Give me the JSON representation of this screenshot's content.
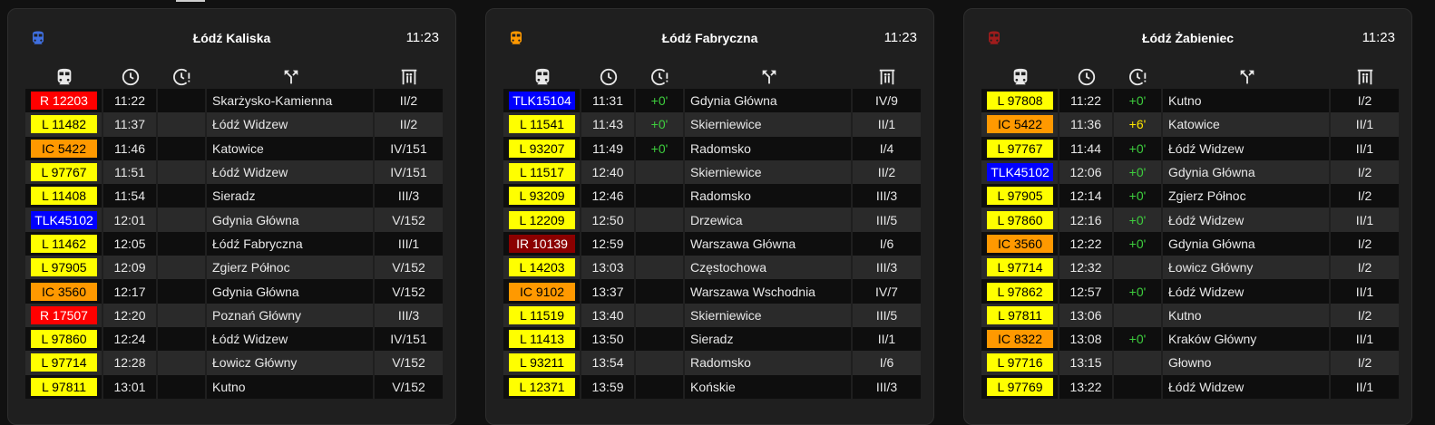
{
  "colors": {
    "L": {
      "bg": "#ffff00",
      "fg": "#000000"
    },
    "R": {
      "bg": "#ff0000",
      "fg": "#ffffff"
    },
    "IC": {
      "bg": "#ff9900",
      "fg": "#000000"
    },
    "TLK": {
      "bg": "#0000ff",
      "fg": "#ffffff"
    },
    "IR": {
      "bg": "#8b0000",
      "fg": "#ffffff"
    },
    "delay_on_time": "#3ecf3e",
    "delay_late": "#ffe600"
  },
  "columns": {
    "train_icon": "train-icon",
    "time_icon": "clock-icon",
    "delay_icon": "clock-alert-icon",
    "destination_icon": "directions-fork-icon",
    "platform_icon": "platform-icon"
  },
  "boards": [
    {
      "station": "Łódź Kaliska",
      "time": "11:23",
      "icon_color": "#3f6fe0",
      "departures": [
        {
          "train": "R 12203",
          "type": "R",
          "time": "11:22",
          "delay": "",
          "destination": "Skarżysko-Kamienna",
          "platform": "II/2"
        },
        {
          "train": "L 11482",
          "type": "L",
          "time": "11:37",
          "delay": "",
          "destination": "Łódź Widzew",
          "platform": "II/2"
        },
        {
          "train": "IC 5422",
          "type": "IC",
          "time": "11:46",
          "delay": "",
          "destination": "Katowice",
          "platform": "IV/151"
        },
        {
          "train": "L 97767",
          "type": "L",
          "time": "11:51",
          "delay": "",
          "destination": "Łódź Widzew",
          "platform": "IV/151"
        },
        {
          "train": "L 11408",
          "type": "L",
          "time": "11:54",
          "delay": "",
          "destination": "Sieradz",
          "platform": "III/3"
        },
        {
          "train": "TLK45102",
          "type": "TLK",
          "time": "12:01",
          "delay": "",
          "destination": "Gdynia Główna",
          "platform": "V/152"
        },
        {
          "train": "L 11462",
          "type": "L",
          "time": "12:05",
          "delay": "",
          "destination": "Łódź Fabryczna",
          "platform": "III/1"
        },
        {
          "train": "L 97905",
          "type": "L",
          "time": "12:09",
          "delay": "",
          "destination": "Zgierz Północ",
          "platform": "V/152"
        },
        {
          "train": "IC 3560",
          "type": "IC",
          "time": "12:17",
          "delay": "",
          "destination": "Gdynia Główna",
          "platform": "V/152"
        },
        {
          "train": "R 17507",
          "type": "R",
          "time": "12:20",
          "delay": "",
          "destination": "Poznań Główny",
          "platform": "III/3"
        },
        {
          "train": "L 97860",
          "type": "L",
          "time": "12:24",
          "delay": "",
          "destination": "Łódź Widzew",
          "platform": "IV/151"
        },
        {
          "train": "L 97714",
          "type": "L",
          "time": "12:28",
          "delay": "",
          "destination": "Łowicz Główny",
          "platform": "V/152"
        },
        {
          "train": "L 97811",
          "type": "L",
          "time": "13:01",
          "delay": "",
          "destination": "Kutno",
          "platform": "V/152"
        }
      ]
    },
    {
      "station": "Łódź Fabryczna",
      "time": "11:23",
      "icon_color": "#ff9900",
      "departures": [
        {
          "train": "TLK15104",
          "type": "TLK",
          "time": "11:31",
          "delay": "+0'",
          "delay_class": "green",
          "destination": "Gdynia Główna",
          "platform": "IV/9"
        },
        {
          "train": "L 11541",
          "type": "L",
          "time": "11:43",
          "delay": "+0'",
          "delay_class": "green",
          "destination": "Skierniewice",
          "platform": "II/1"
        },
        {
          "train": "L 93207",
          "type": "L",
          "time": "11:49",
          "delay": "+0'",
          "delay_class": "green",
          "destination": "Radomsko",
          "platform": "I/4"
        },
        {
          "train": "L 11517",
          "type": "L",
          "time": "12:40",
          "delay": "",
          "destination": "Skierniewice",
          "platform": "II/2"
        },
        {
          "train": "L 93209",
          "type": "L",
          "time": "12:46",
          "delay": "",
          "destination": "Radomsko",
          "platform": "III/3"
        },
        {
          "train": "L 12209",
          "type": "L",
          "time": "12:50",
          "delay": "",
          "destination": "Drzewica",
          "platform": "III/5"
        },
        {
          "train": "IR 10139",
          "type": "IR",
          "time": "12:59",
          "delay": "",
          "destination": "Warszawa Główna",
          "platform": "I/6"
        },
        {
          "train": "L 14203",
          "type": "L",
          "time": "13:03",
          "delay": "",
          "destination": "Częstochowa",
          "platform": "III/3"
        },
        {
          "train": "IC 9102",
          "type": "IC",
          "time": "13:37",
          "delay": "",
          "destination": "Warszawa Wschodnia",
          "platform": "IV/7"
        },
        {
          "train": "L 11519",
          "type": "L",
          "time": "13:40",
          "delay": "",
          "destination": "Skierniewice",
          "platform": "III/5"
        },
        {
          "train": "L 11413",
          "type": "L",
          "time": "13:50",
          "delay": "",
          "destination": "Sieradz",
          "platform": "II/1"
        },
        {
          "train": "L 93211",
          "type": "L",
          "time": "13:54",
          "delay": "",
          "destination": "Radomsko",
          "platform": "I/6"
        },
        {
          "train": "L 12371",
          "type": "L",
          "time": "13:59",
          "delay": "",
          "destination": "Końskie",
          "platform": "III/3"
        }
      ]
    },
    {
      "station": "Łódź Żabieniec",
      "time": "11:23",
      "icon_color": "#a01c1c",
      "departures": [
        {
          "train": "L 97808",
          "type": "L",
          "time": "11:22",
          "delay": "+0'",
          "delay_class": "green",
          "destination": "Kutno",
          "platform": "I/2"
        },
        {
          "train": "IC 5422",
          "type": "IC",
          "time": "11:36",
          "delay": "+6'",
          "delay_class": "yellow",
          "destination": "Katowice",
          "platform": "II/1"
        },
        {
          "train": "L 97767",
          "type": "L",
          "time": "11:44",
          "delay": "+0'",
          "delay_class": "green",
          "destination": "Łódź Widzew",
          "platform": "II/1"
        },
        {
          "train": "TLK45102",
          "type": "TLK",
          "time": "12:06",
          "delay": "+0'",
          "delay_class": "green",
          "destination": "Gdynia Główna",
          "platform": "I/2"
        },
        {
          "train": "L 97905",
          "type": "L",
          "time": "12:14",
          "delay": "+0'",
          "delay_class": "green",
          "destination": "Zgierz Północ",
          "platform": "I/2"
        },
        {
          "train": "L 97860",
          "type": "L",
          "time": "12:16",
          "delay": "+0'",
          "delay_class": "green",
          "destination": "Łódź Widzew",
          "platform": "II/1"
        },
        {
          "train": "IC 3560",
          "type": "IC",
          "time": "12:22",
          "delay": "+0'",
          "delay_class": "green",
          "destination": "Gdynia Główna",
          "platform": "I/2"
        },
        {
          "train": "L 97714",
          "type": "L",
          "time": "12:32",
          "delay": "",
          "destination": "Łowicz Główny",
          "platform": "I/2"
        },
        {
          "train": "L 97862",
          "type": "L",
          "time": "12:57",
          "delay": "+0'",
          "delay_class": "green",
          "destination": "Łódź Widzew",
          "platform": "II/1"
        },
        {
          "train": "L 97811",
          "type": "L",
          "time": "13:06",
          "delay": "",
          "destination": "Kutno",
          "platform": "I/2"
        },
        {
          "train": "IC 8322",
          "type": "IC",
          "time": "13:08",
          "delay": "+0'",
          "delay_class": "green",
          "destination": "Kraków Główny",
          "platform": "II/1"
        },
        {
          "train": "L 97716",
          "type": "L",
          "time": "13:15",
          "delay": "",
          "destination": "Głowno",
          "platform": "I/2"
        },
        {
          "train": "L 97769",
          "type": "L",
          "time": "13:22",
          "delay": "",
          "destination": "Łódź Widzew",
          "platform": "II/1"
        }
      ]
    }
  ]
}
